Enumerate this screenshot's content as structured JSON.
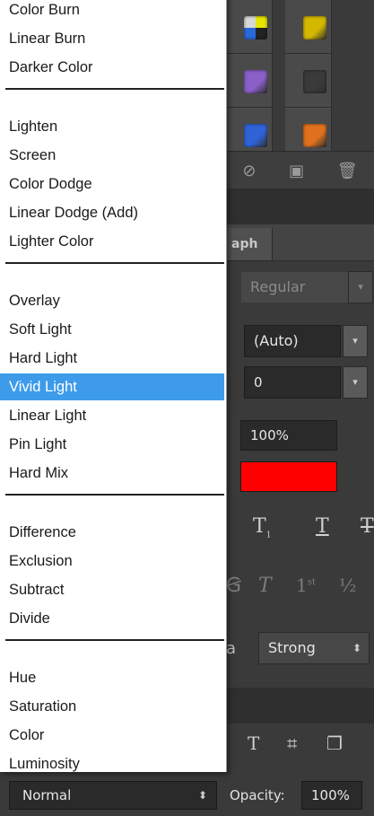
{
  "blend_menu": {
    "selected": "Vivid Light",
    "groups": [
      {
        "items": [
          "Color Burn",
          "Linear Burn",
          "Darker Color"
        ]
      },
      {
        "items": [
          "Lighten",
          "Screen",
          "Color Dodge",
          "Linear Dodge (Add)",
          "Lighter Color"
        ]
      },
      {
        "items": [
          "Overlay",
          "Soft Light",
          "Hard Light",
          "Vivid Light",
          "Linear Light",
          "Pin Light",
          "Hard Mix"
        ]
      },
      {
        "items": [
          "Difference",
          "Exclusion",
          "Subtract",
          "Divide"
        ]
      },
      {
        "items": [
          "Hue",
          "Saturation",
          "Color",
          "Luminosity"
        ]
      }
    ]
  },
  "styles_panel": {
    "swatch_colors": [
      "#d4b800",
      "#8a5fc8",
      "#2f63d6",
      "#e0701e",
      "#3a3a3a"
    ],
    "toolbar_icons": [
      "no-style-icon",
      "new-style-icon",
      "trash-icon"
    ]
  },
  "character_panel": {
    "tab_label": "aph",
    "font_style": "Regular",
    "leading": "(Auto)",
    "tracking": "0",
    "scale": "100%",
    "text_color": "#ff0000",
    "style_glyphs": [
      "T",
      "T",
      "T"
    ],
    "opentype_glyphs": [
      "T",
      "1st",
      "½"
    ],
    "anti_alias_prefix": "a",
    "anti_alias": "Strong"
  },
  "layers_bar": {
    "blend_mode": "Normal",
    "opacity_label": "Opacity:",
    "opacity_value": "100%",
    "icons": [
      "type-icon",
      "transform-icon",
      "copy-icon"
    ]
  }
}
